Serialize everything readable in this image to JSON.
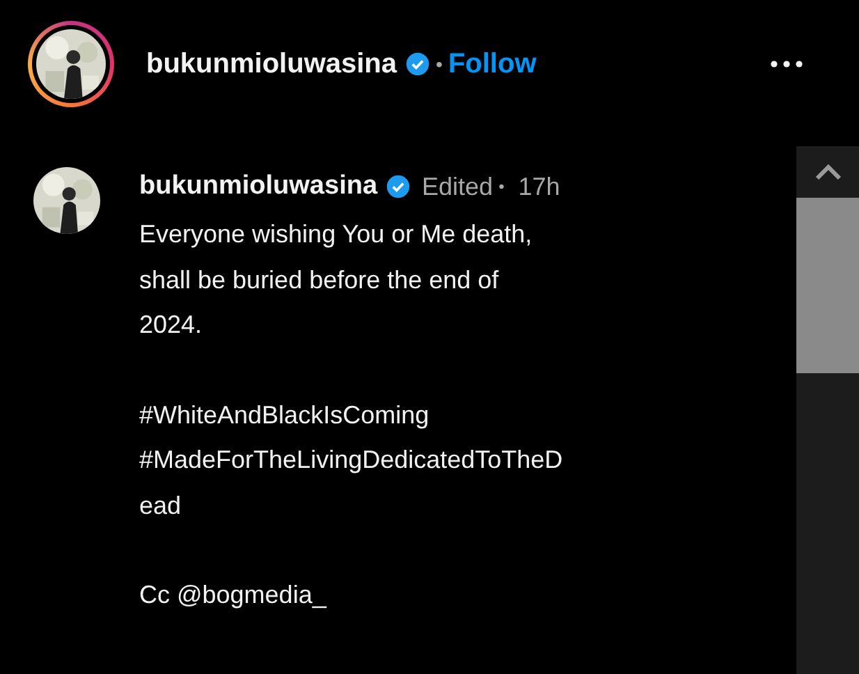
{
  "header": {
    "username": "bukunmioluwasina",
    "verified": true,
    "separator": "•",
    "follow": "Follow"
  },
  "caption": {
    "username": "bukunmioluwasina",
    "verified": true,
    "edited": "Edited",
    "separator": "•",
    "time": "17h",
    "paragraphs": [
      {
        "lines": [
          "Everyone wishing You or Me death,",
          "shall be buried before the end of",
          "2024."
        ]
      },
      {
        "lines": [
          "#WhiteAndBlackIsComing",
          "#MadeForTheLivingDedicatedToTheD",
          "ead"
        ]
      },
      {
        "lines": [
          "Cc @bogmedia_"
        ]
      }
    ]
  }
}
